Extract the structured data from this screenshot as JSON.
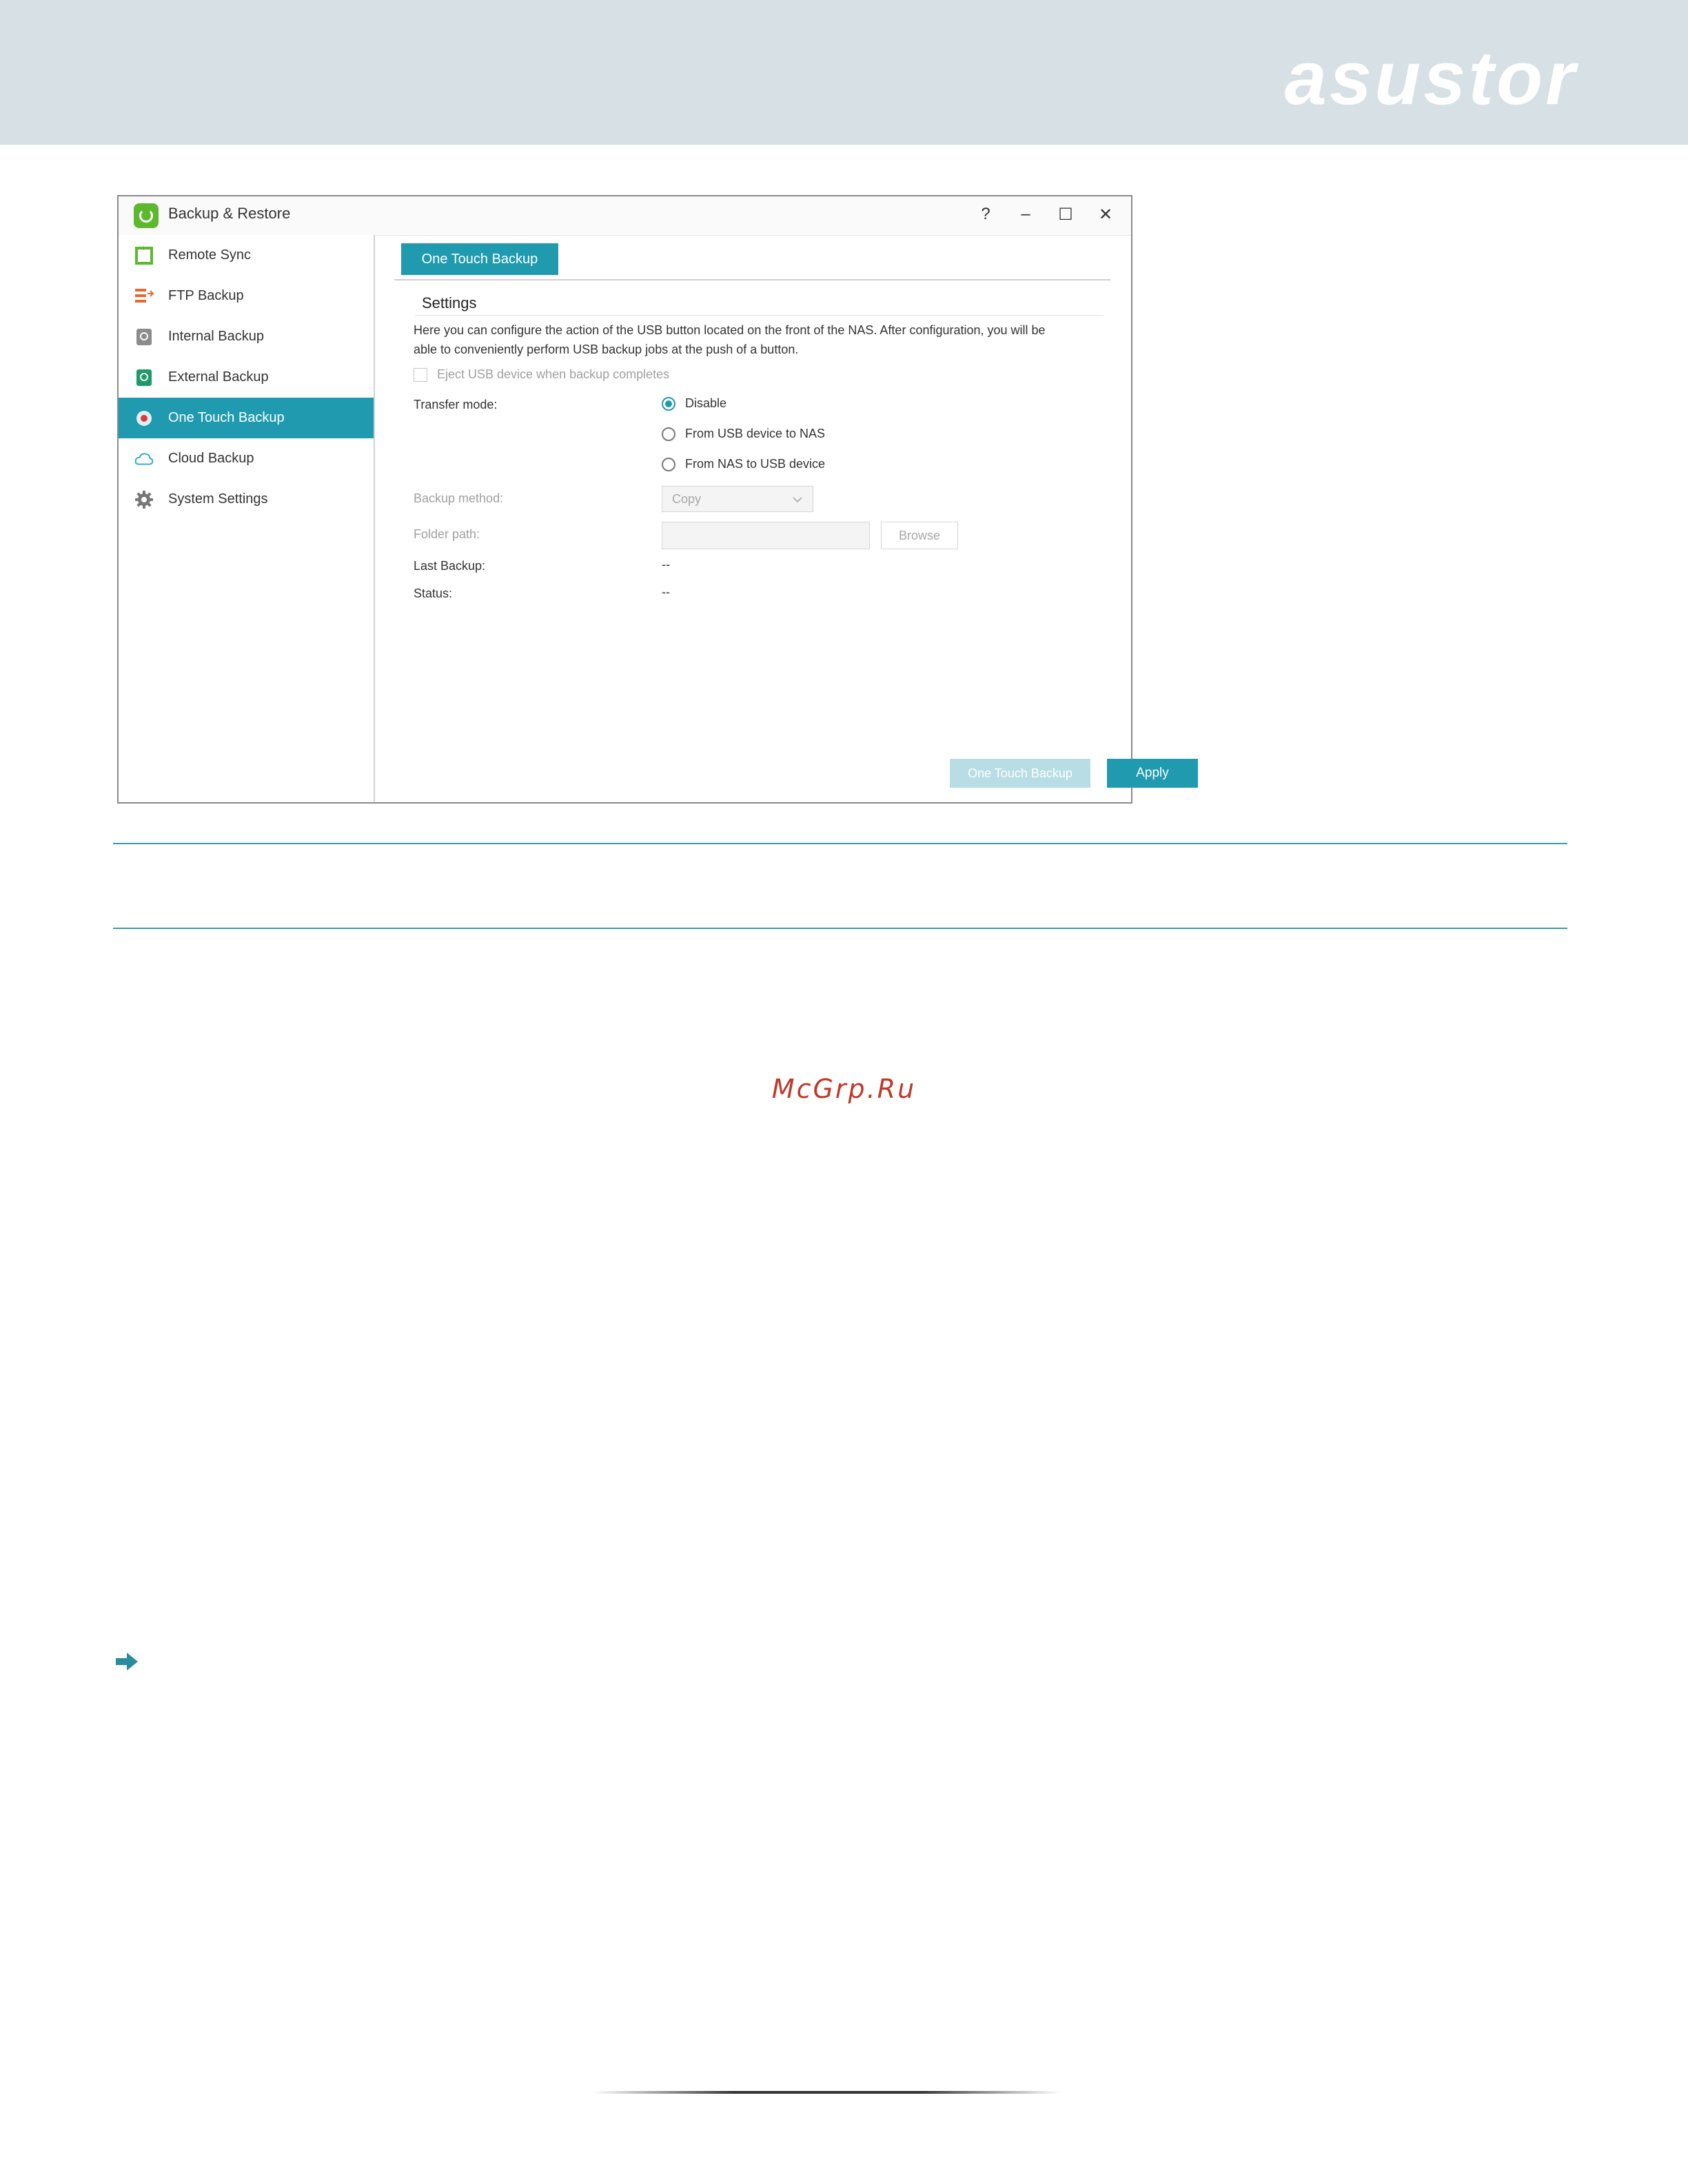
{
  "brand": "asustor",
  "window": {
    "title": "Backup & Restore",
    "controls": [
      "?",
      "–",
      "☐",
      "✕"
    ]
  },
  "sidebar": {
    "items": [
      {
        "label": "Remote Sync",
        "icon": "remote-sync-icon"
      },
      {
        "label": "FTP Backup",
        "icon": "ftp-backup-icon"
      },
      {
        "label": "Internal Backup",
        "icon": "internal-backup-icon"
      },
      {
        "label": "External Backup",
        "icon": "external-backup-icon"
      },
      {
        "label": "One Touch Backup",
        "icon": "one-touch-backup-icon",
        "active": true
      },
      {
        "label": "Cloud Backup",
        "icon": "cloud-backup-icon"
      },
      {
        "label": "System Settings",
        "icon": "gear-icon"
      }
    ]
  },
  "main": {
    "tab": "One Touch Backup",
    "section_title": "Settings",
    "description_line1": "Here you can configure the action of the USB button located on the front of the NAS. After configuration, you will be",
    "description_line2": "able to conveniently perform USB backup jobs at the push of a button.",
    "eject_label": "Eject USB device when backup completes",
    "transfer_mode_label": "Transfer mode:",
    "transfer_options": [
      "Disable",
      "From USB device to NAS",
      "From NAS to USB device"
    ],
    "transfer_selected": "Disable",
    "backup_method_label": "Backup method:",
    "backup_method_value": "Copy",
    "folder_path_label": "Folder path:",
    "folder_path_value": "",
    "browse_label": "Browse",
    "last_backup_label": "Last Backup:",
    "last_backup_value": "--",
    "status_label": "Status:",
    "status_value": "--",
    "one_touch_button": "One Touch Backup",
    "apply_button": "Apply"
  },
  "watermark": "McGrp.Ru",
  "colors": {
    "accent": "#1f9aae",
    "banner": "#d6e0e5",
    "rule": "#3a9aab"
  }
}
